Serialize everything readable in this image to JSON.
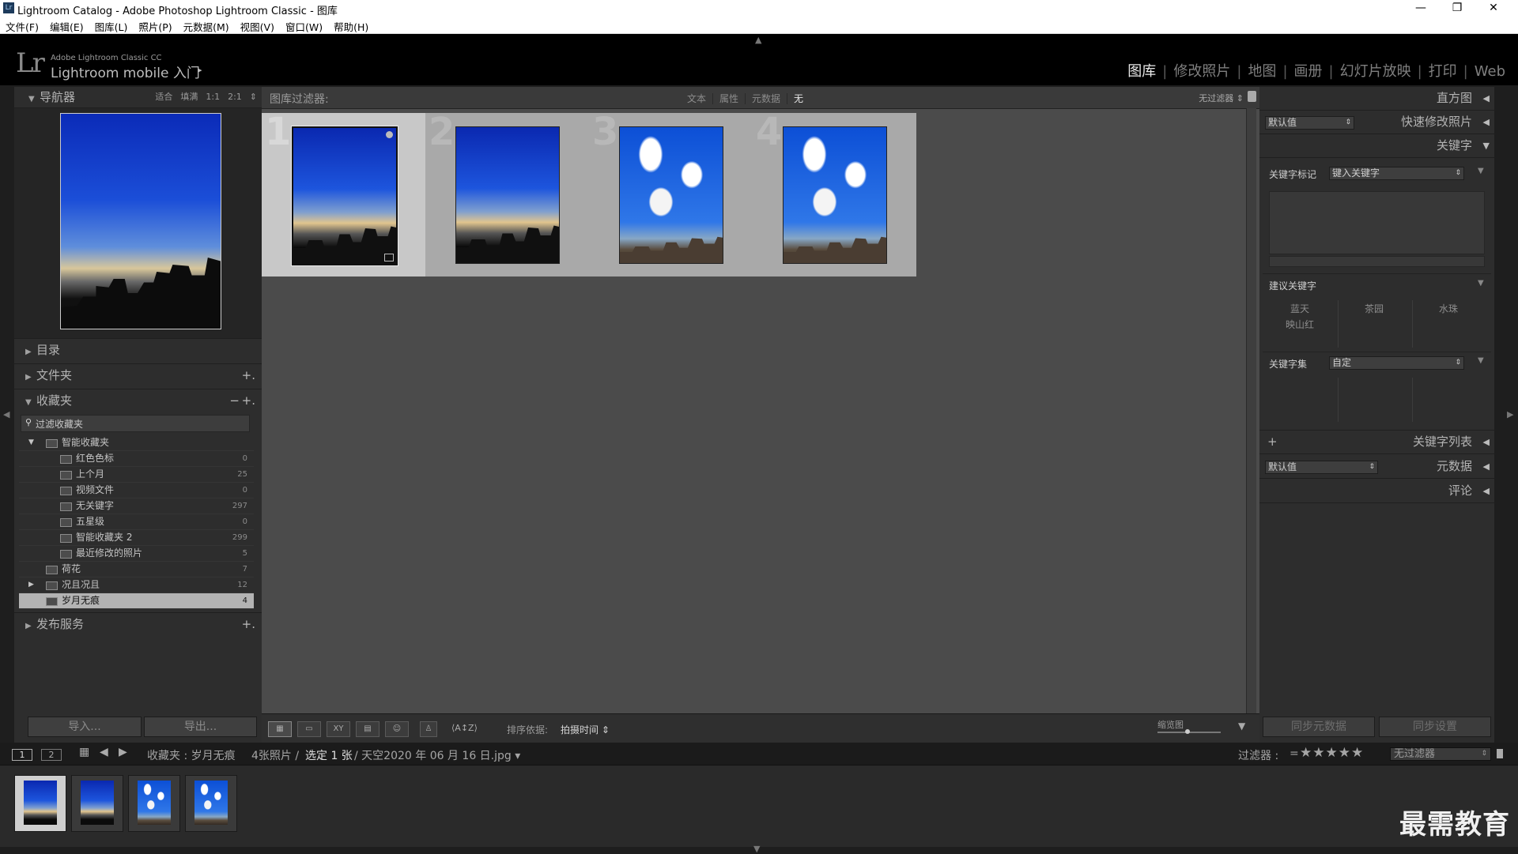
{
  "window": {
    "title": "Lightroom Catalog - Adobe Photoshop Lightroom Classic - 图库",
    "icon_text": "Lr",
    "minimize": "—",
    "maximize": "❐",
    "close": "✕"
  },
  "menu": [
    "文件(F)",
    "编辑(E)",
    "图库(L)",
    "照片(P)",
    "元数据(M)",
    "视图(V)",
    "窗口(W)",
    "帮助(H)"
  ],
  "identity": {
    "logo": "Lr",
    "small": "Adobe Lightroom Classic CC",
    "big": "Lightroom mobile 入门",
    "arrow": "▸"
  },
  "modules": [
    "图库",
    "修改照片",
    "地图",
    "画册",
    "幻灯片放映",
    "打印",
    "Web"
  ],
  "active_module": "图库",
  "navigator": {
    "title": "导航器",
    "options": [
      "适合",
      "填满",
      "1:1",
      "2:1"
    ],
    "stepper": "⇕"
  },
  "left_sections": {
    "catalog": "目录",
    "folders": "文件夹",
    "collections": "收藏夹",
    "publish": "发布服务",
    "plus": "+.",
    "minus": "−"
  },
  "collection_filter_placeholder": "过滤收藏夹",
  "collections": [
    {
      "name": "智能收藏夹",
      "count": "",
      "level": 1,
      "type": "set",
      "expanded": true
    },
    {
      "name": "红色色标",
      "count": "0",
      "level": 2,
      "type": "smart"
    },
    {
      "name": "上个月",
      "count": "25",
      "level": 2,
      "type": "smart"
    },
    {
      "name": "视频文件",
      "count": "0",
      "level": 2,
      "type": "smart"
    },
    {
      "name": "无关键字",
      "count": "297",
      "level": 2,
      "type": "smart"
    },
    {
      "name": "五星级",
      "count": "0",
      "level": 2,
      "type": "smart"
    },
    {
      "name": "智能收藏夹 2",
      "count": "299",
      "level": 2,
      "type": "smart"
    },
    {
      "name": "最近修改的照片",
      "count": "5",
      "level": 2,
      "type": "smart"
    },
    {
      "name": "荷花",
      "count": "7",
      "level": 1,
      "type": "collection"
    },
    {
      "name": "况且况且",
      "count": "12",
      "level": 1,
      "type": "set"
    },
    {
      "name": "岁月无痕",
      "count": "4",
      "level": 1,
      "type": "collection",
      "selected": true
    }
  ],
  "left_buttons": {
    "import": "导入...",
    "export": "导出..."
  },
  "filter_bar": {
    "label": "图库过滤器:",
    "options": [
      "文本",
      "属性",
      "元数据",
      "无"
    ],
    "active": "无",
    "preset": "无过滤器 ⇕"
  },
  "grid": [
    {
      "index": "1",
      "style": "sunset",
      "selected": true
    },
    {
      "index": "2",
      "style": "sunset",
      "selected": false
    },
    {
      "index": "3",
      "style": "sky",
      "selected": false
    },
    {
      "index": "4",
      "style": "sky",
      "selected": false
    }
  ],
  "toolbar": {
    "view_grid": "▦",
    "view_loupe": "▭",
    "view_compare": "XY",
    "view_survey": "▤",
    "view_people": "☺",
    "spray": "♙",
    "sort_direction": "⟨A↕Z⟩",
    "sort_label": "排序依据:",
    "sort_value": "拍摄时间 ⇕",
    "zoom_label": "缩览图",
    "menu": "▼"
  },
  "right_panel": {
    "histogram": "直方图",
    "preset_default": "默认值",
    "quick_develop": "快速修改照片",
    "keywording": "关键字",
    "keyword_tags_label": "关键字标记",
    "keyword_tags_select": "键入关键字",
    "suggested_label": "建议关键字",
    "suggested": [
      "蓝天",
      "茶园",
      "水珠",
      "映山红"
    ],
    "keyword_set_label": "关键字集",
    "keyword_set_select": "自定",
    "keyword_list": "关键字列表",
    "metadata": "元数据",
    "metadata_preset": "默认值",
    "comments": "评论",
    "sync_metadata": "同步元数据",
    "sync_settings": "同步设置",
    "plus": "+"
  },
  "filmstrip_bar": {
    "page1": "1",
    "page2": "2",
    "source_label": "收藏夹 : 岁月无痕",
    "count_text": "4张照片 /",
    "selected_text": "选定 1 张",
    "file_text": "/ 天空2020 年 06 月 16 日.jpg ▾",
    "filter_label": "过滤器 :",
    "equals": "=",
    "stars": "★★★★★",
    "filter_select": "无过滤器"
  },
  "filmstrip": [
    {
      "style": "sunset",
      "selected": true
    },
    {
      "style": "sunset",
      "selected": false
    },
    {
      "style": "sky",
      "selected": false
    },
    {
      "style": "sky",
      "selected": false
    }
  ],
  "watermark": "最需教育",
  "colors": {
    "background": "#1e1e1e",
    "panel": "#2d2d2d",
    "grid_bg": "#4b4b4b",
    "active_text": "#e8e8e8"
  }
}
